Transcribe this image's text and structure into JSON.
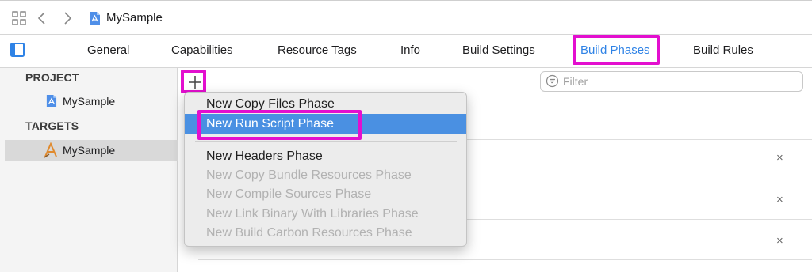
{
  "window": {
    "project_name": "MySample"
  },
  "tabs": [
    {
      "label": "General"
    },
    {
      "label": "Capabilities"
    },
    {
      "label": "Resource Tags"
    },
    {
      "label": "Info"
    },
    {
      "label": "Build Settings"
    },
    {
      "label": "Build Phases"
    },
    {
      "label": "Build Rules"
    }
  ],
  "active_tab": "Build Phases",
  "sidebar": {
    "project_header": "PROJECT",
    "project_item": "MySample",
    "targets_header": "TARGETS",
    "target_item": "MySample"
  },
  "filter": {
    "placeholder": "Filter"
  },
  "menu": {
    "items": [
      {
        "label": "New Copy Files Phase",
        "enabled": true
      },
      {
        "label": "New Run Script Phase",
        "enabled": true,
        "selected": true
      },
      {
        "label": "New Headers Phase",
        "enabled": true
      },
      {
        "label": "New Copy Bundle Resources Phase",
        "enabled": false
      },
      {
        "label": "New Compile Sources Phase",
        "enabled": false
      },
      {
        "label": "New Link Binary With Libraries Phase",
        "enabled": false
      },
      {
        "label": "New Build Carbon Resources Phase",
        "enabled": false
      }
    ]
  },
  "phase_remove_label": "×",
  "colors": {
    "accent": "#2f83e6",
    "highlight_annotation": "#e30fcf",
    "menu_selection": "#4a90e2"
  }
}
